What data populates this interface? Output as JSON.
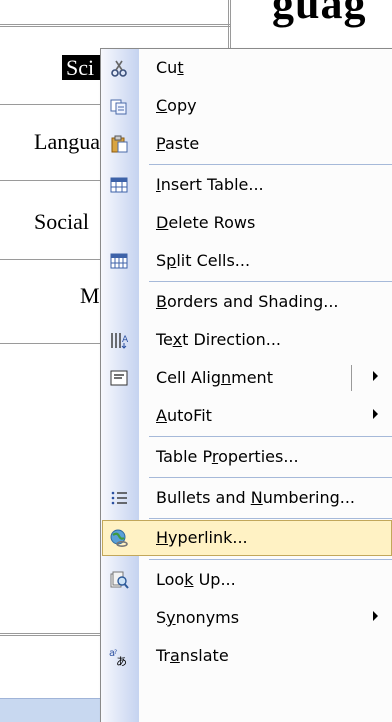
{
  "document": {
    "title_fragment": "guag",
    "cells": [
      "Sci",
      "Langua",
      "Social",
      "M"
    ]
  },
  "menu": {
    "items": [
      {
        "pre": "Cu",
        "u": "t",
        "post": "",
        "icon": "scissors-icon"
      },
      {
        "pre": "",
        "u": "C",
        "post": "opy",
        "icon": "copy-icon"
      },
      {
        "pre": "",
        "u": "P",
        "post": "aste",
        "icon": "paste-icon"
      },
      {
        "pre": "",
        "u": "I",
        "post": "nsert Table...",
        "icon": "insert-table-icon"
      },
      {
        "pre": "",
        "u": "D",
        "post": "elete Rows",
        "icon": ""
      },
      {
        "pre": "S",
        "u": "p",
        "post": "lit Cells...",
        "icon": "split-cells-icon"
      },
      {
        "pre": "",
        "u": "B",
        "post": "orders and Shading...",
        "icon": ""
      },
      {
        "pre": "Te",
        "u": "x",
        "post": "t Direction...",
        "icon": "text-direction-icon"
      },
      {
        "pre": "Cell Alig",
        "u": "n",
        "post": "ment",
        "icon": "cell-alignment-icon"
      },
      {
        "pre": "",
        "u": "A",
        "post": "utoFit",
        "icon": ""
      },
      {
        "pre": "Table P",
        "u": "r",
        "post": "operties...",
        "icon": ""
      },
      {
        "pre": "Bullets and ",
        "u": "N",
        "post": "umbering...",
        "icon": "bullets-icon"
      },
      {
        "pre": "",
        "u": "H",
        "post": "yperlink...",
        "icon": "hyperlink-icon"
      },
      {
        "pre": "Loo",
        "u": "k",
        "post": " Up...",
        "icon": "lookup-icon"
      },
      {
        "pre": "S",
        "u": "y",
        "post": "nonyms",
        "icon": ""
      },
      {
        "pre": "Tr",
        "u": "a",
        "post": "nslate",
        "icon": "translate-icon"
      }
    ],
    "highlight_color": "#fff2c4",
    "gutter_color": "#c5d3f0"
  }
}
